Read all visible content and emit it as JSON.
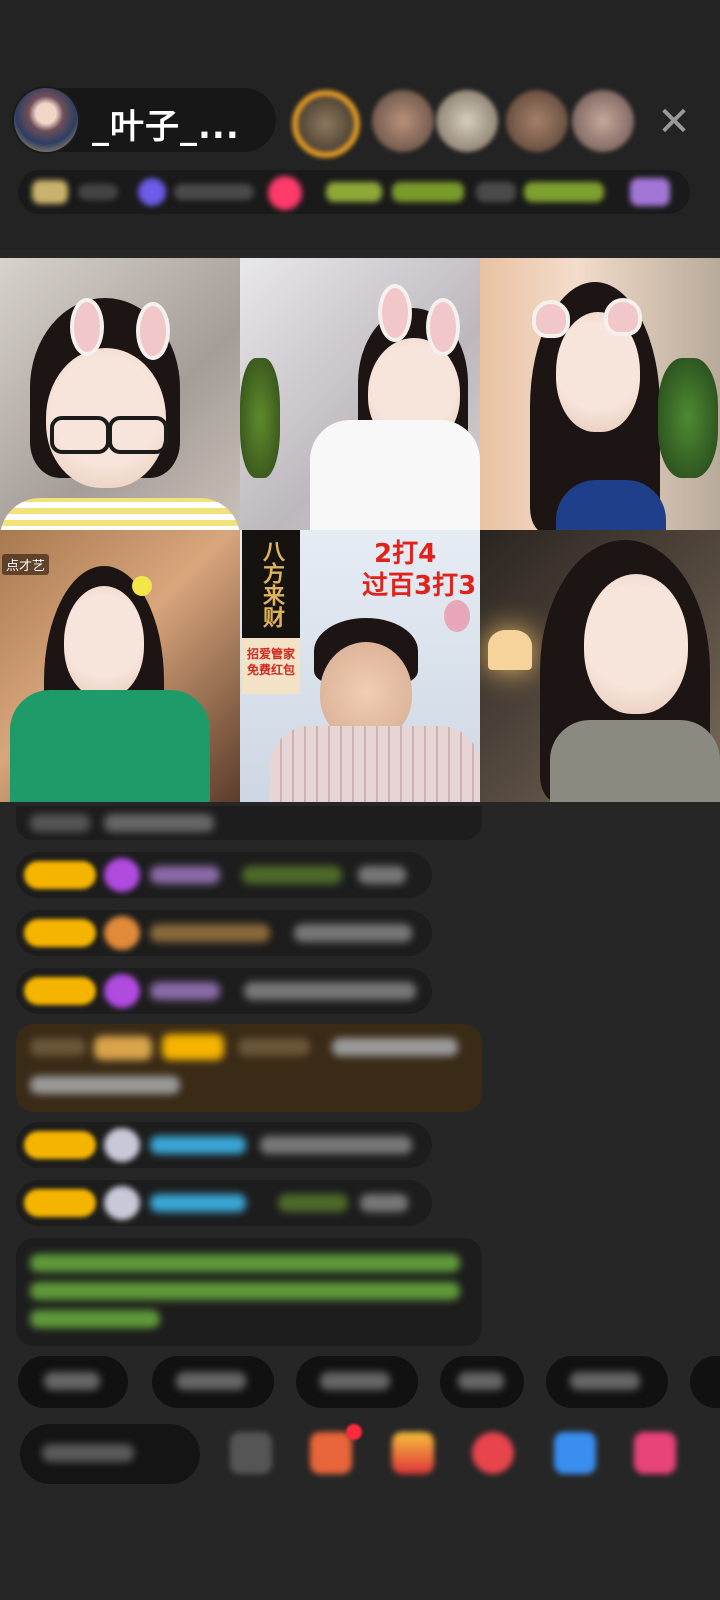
{
  "header": {
    "host_name": "_叶子_..."
  },
  "grid": {
    "cells": [
      {
        "overlay": ""
      },
      {
        "overlay": ""
      },
      {
        "overlay": ""
      },
      {
        "overlay": "点才艺"
      },
      {
        "banner_top": "八方来财",
        "banner_bottom": "招爱管家\n免费红包",
        "sign_line1": "2打4",
        "sign_line2": "过百3打3"
      },
      {
        "overlay": ""
      }
    ]
  },
  "colors": {
    "background": "#262626",
    "badge_gold": "#f4b400",
    "gem_purple": "#b04be0",
    "name_cyan": "#3aa6d6",
    "notice_green": "#7ccf5a"
  }
}
